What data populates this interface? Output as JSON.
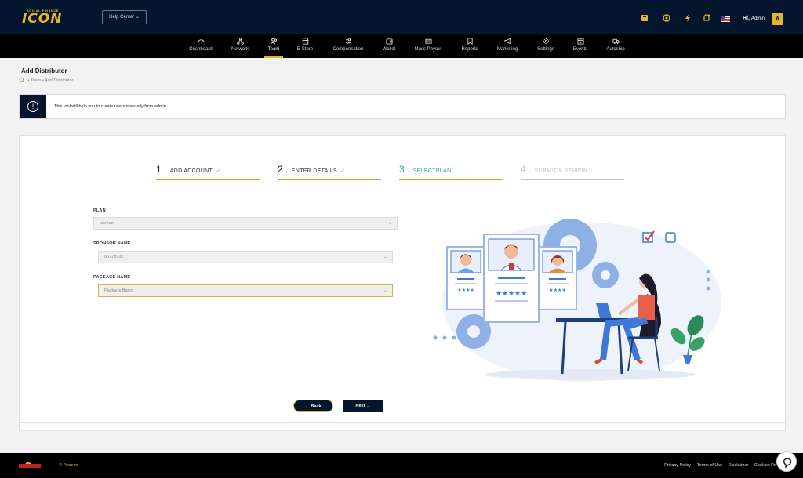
{
  "header": {
    "logo_small": "SOCIAL FINANCE",
    "logo_big": "ICON",
    "help_center": "Help Center ⌄",
    "greeting": "Hi,",
    "user": "Admin",
    "avatar_letter": "A"
  },
  "nav": [
    {
      "label": "Dashboard",
      "icon": "dashboard-icon"
    },
    {
      "label": "Network",
      "icon": "network-icon"
    },
    {
      "label": "Team",
      "icon": "team-icon",
      "active": true
    },
    {
      "label": "E-Store",
      "icon": "store-icon"
    },
    {
      "label": "Compensation",
      "icon": "sliders-icon"
    },
    {
      "label": "Wallet",
      "icon": "wallet-icon"
    },
    {
      "label": "Mass Payout",
      "icon": "payout-icon"
    },
    {
      "label": "Reports",
      "icon": "reports-icon"
    },
    {
      "label": "Marketing",
      "icon": "megaphone-icon"
    },
    {
      "label": "Settings",
      "icon": "gear-icon"
    },
    {
      "label": "Events",
      "icon": "calendar-icon"
    },
    {
      "label": "Autoship",
      "icon": "truck-icon"
    }
  ],
  "page": {
    "title": "Add Distributor",
    "breadcrumb": "• Team • Add Distributor"
  },
  "alert": {
    "icon": "!",
    "text": "This tool will help you to create users manually from admin"
  },
  "steps": [
    {
      "num": "1 .",
      "label": "ADD ACCOUNT",
      "check": "✓"
    },
    {
      "num": "2 .",
      "label": "ENTER DETAILS",
      "check": "✓"
    },
    {
      "num": "3 .",
      "label": "SELECTPLAN",
      "check": ""
    },
    {
      "num": "4 .",
      "label": "SUBMIT & REVIEW",
      "check": ""
    }
  ],
  "form": {
    "plan_label": "PLAN",
    "plan_value": "icomum",
    "sponsor_label": "SPONSOR NAME",
    "sponsor_value": "80778932",
    "package_label": "PACKAGE NAME",
    "package_value": "Package Basic"
  },
  "buttons": {
    "back": "← Back",
    "next": "Next →"
  },
  "footer": {
    "copyright": "© Promlm",
    "links": [
      "Privacy Policy",
      "Terms of Use",
      "Disclaimer",
      "Cookies Po"
    ]
  },
  "colors": {
    "navy": "#04162e",
    "gold": "#e2b52a",
    "teal": "#20a99f",
    "illustration_blue": "#3f78d6"
  }
}
